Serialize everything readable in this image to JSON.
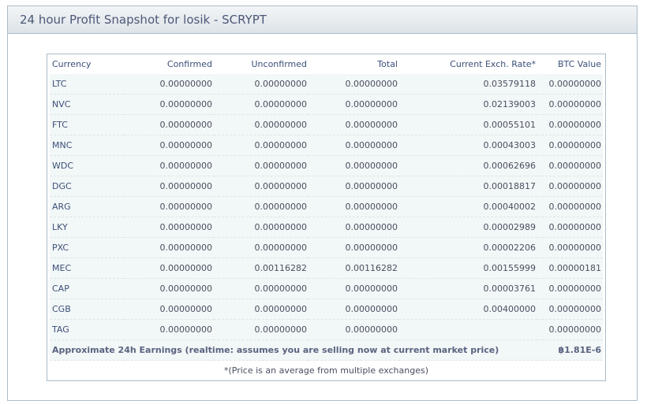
{
  "panel": {
    "title": "24 hour Profit Snapshot for losik - SCRYPT"
  },
  "table": {
    "headers": [
      "Currency",
      "Confirmed",
      "Unconfirmed",
      "Total",
      "Current Exch. Rate*",
      "BTC Value"
    ],
    "rows": [
      [
        "LTC",
        "0.00000000",
        "0.00000000",
        "0.00000000",
        "0.03579118",
        "0.00000000"
      ],
      [
        "NVC",
        "0.00000000",
        "0.00000000",
        "0.00000000",
        "0.02139003",
        "0.00000000"
      ],
      [
        "FTC",
        "0.00000000",
        "0.00000000",
        "0.00000000",
        "0.00055101",
        "0.00000000"
      ],
      [
        "MNC",
        "0.00000000",
        "0.00000000",
        "0.00000000",
        "0.00043003",
        "0.00000000"
      ],
      [
        "WDC",
        "0.00000000",
        "0.00000000",
        "0.00000000",
        "0.00062696",
        "0.00000000"
      ],
      [
        "DGC",
        "0.00000000",
        "0.00000000",
        "0.00000000",
        "0.00018817",
        "0.00000000"
      ],
      [
        "ARG",
        "0.00000000",
        "0.00000000",
        "0.00000000",
        "0.00040002",
        "0.00000000"
      ],
      [
        "LKY",
        "0.00000000",
        "0.00000000",
        "0.00000000",
        "0.00002989",
        "0.00000000"
      ],
      [
        "PXC",
        "0.00000000",
        "0.00000000",
        "0.00000000",
        "0.00002206",
        "0.00000000"
      ],
      [
        "MEC",
        "0.00000000",
        "0.00116282",
        "0.00116282",
        "0.00155999",
        "0.00000181"
      ],
      [
        "CAP",
        "0.00000000",
        "0.00000000",
        "0.00000000",
        "0.00003761",
        "0.00000000"
      ],
      [
        "CGB",
        "0.00000000",
        "0.00000000",
        "0.00000000",
        "0.00400000",
        "0.00000000"
      ],
      [
        "TAG",
        "0.00000000",
        "0.00000000",
        "0.00000000",
        "",
        "0.00000000"
      ]
    ],
    "summary_label": "Approximate 24h Earnings (realtime: assumes you are selling now at current market price)",
    "summary_value": "฿1.81E-6",
    "footnote": "*(Price is an average from multiple exchanges)"
  }
}
